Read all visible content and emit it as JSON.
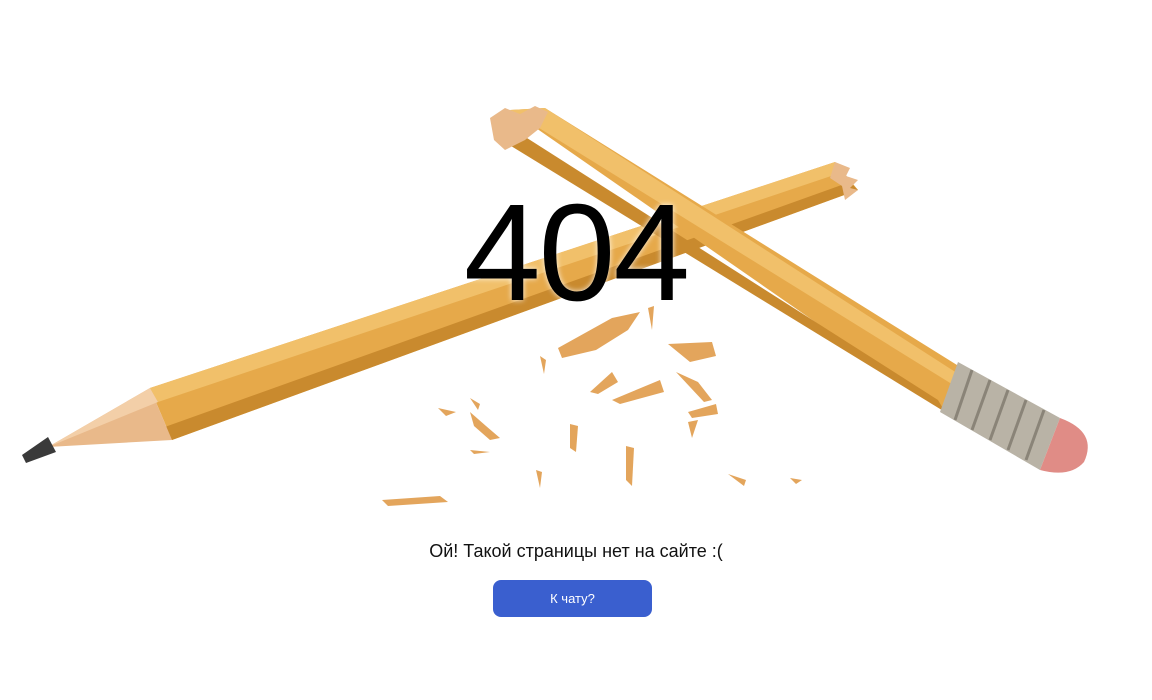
{
  "error": {
    "code": "404",
    "message": "Ой! Такой страницы нет на сайте :("
  },
  "actions": {
    "chat_button_label": "К чату?"
  },
  "illustration": {
    "subject": "broken-pencil",
    "colors": {
      "pencil_body": "#e6a94a",
      "pencil_shadow": "#c98a2e",
      "wood": "#e9b98a",
      "graphite": "#3a3a3a",
      "ferrule": "#b9b3a6",
      "eraser": "#e08c86",
      "button": "#3a5fcf"
    }
  }
}
